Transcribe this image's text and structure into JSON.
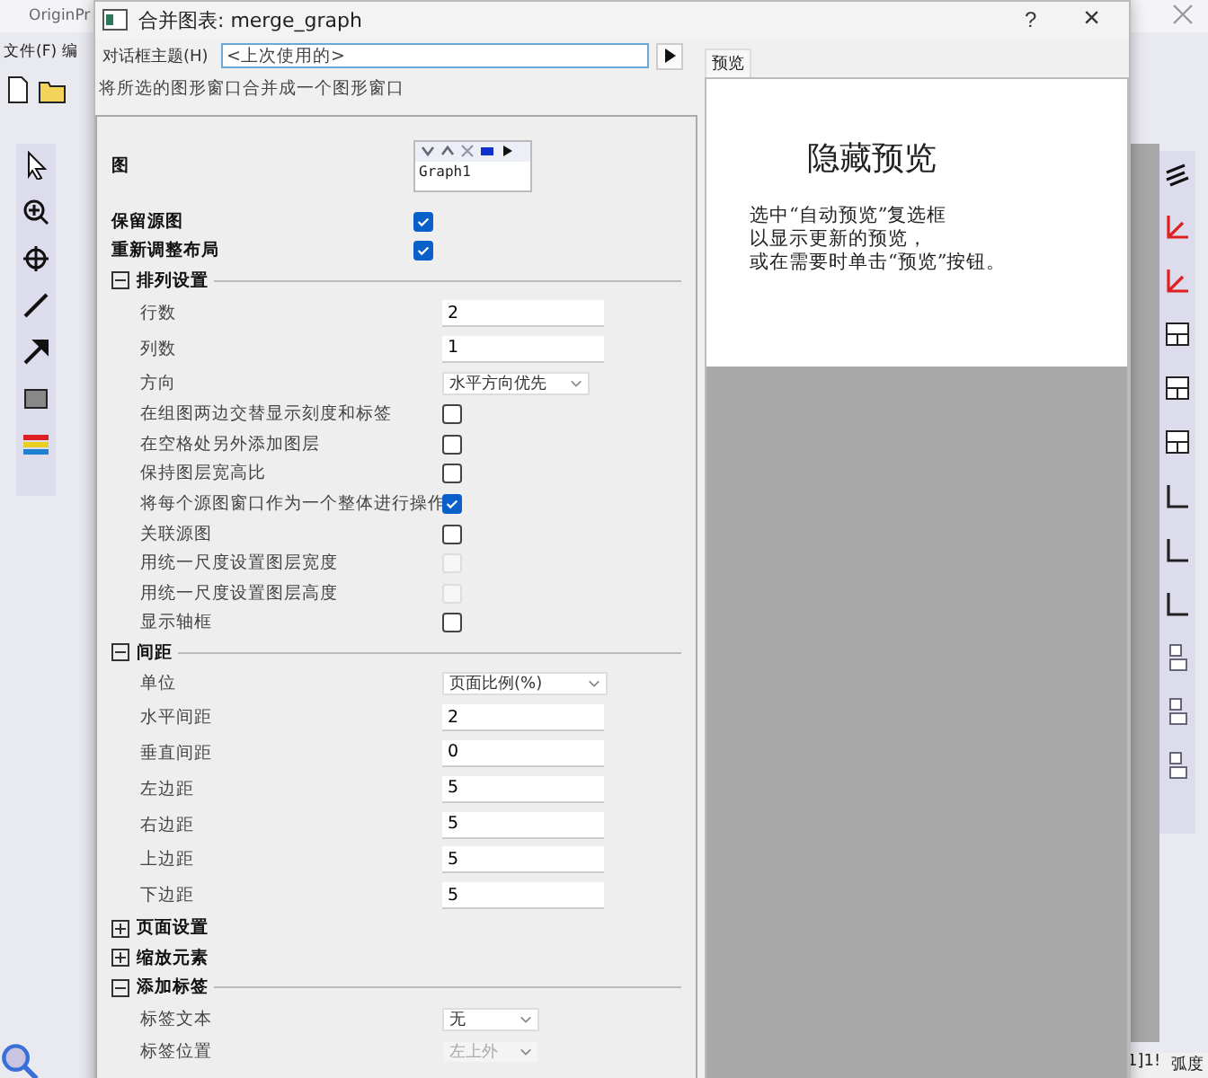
{
  "app": {
    "title": "OriginPr",
    "menu": [
      "文件(F)",
      "编"
    ],
    "status_bar": [
      "1]1!",
      "弧度"
    ]
  },
  "dialog": {
    "title": "合并图表: merge_graph",
    "help": "?",
    "close": "×",
    "theme": {
      "label": "对话框主题(H)",
      "value": "<上次使用的>"
    },
    "description": "将所选的图形窗口合并成一个图形窗口",
    "items": [
      {
        "kind": "graphlist",
        "label": "图",
        "graphs": [
          "Graph1"
        ]
      },
      {
        "kind": "check",
        "label": "保留源图",
        "checked": true,
        "disabled": false
      },
      {
        "kind": "check",
        "label": "重新调整布局",
        "checked": true,
        "disabled": false
      },
      {
        "kind": "section",
        "label": "排列设置",
        "expanded": true,
        "children": [
          {
            "kind": "input",
            "label": "行数",
            "value": "2"
          },
          {
            "kind": "input",
            "label": "列数",
            "value": "1"
          },
          {
            "kind": "select",
            "label": "方向",
            "value": "水平方向优先",
            "disabled": false
          },
          {
            "kind": "check",
            "label": "在组图两边交替显示刻度和标签",
            "checked": false,
            "disabled": false
          },
          {
            "kind": "check",
            "label": "在空格处另外添加图层",
            "checked": false,
            "disabled": false
          },
          {
            "kind": "check",
            "label": "保持图层宽高比",
            "checked": false,
            "disabled": false
          },
          {
            "kind": "check",
            "label": "将每个源图窗口作为一个整体进行操作",
            "checked": true,
            "disabled": false
          },
          {
            "kind": "check",
            "label": "关联源图",
            "checked": false,
            "disabled": false
          },
          {
            "kind": "check",
            "label": "用统一尺度设置图层宽度",
            "checked": false,
            "disabled": true
          },
          {
            "kind": "check",
            "label": "用统一尺度设置图层高度",
            "checked": false,
            "disabled": true
          },
          {
            "kind": "check",
            "label": "显示轴框",
            "checked": false,
            "disabled": false
          }
        ]
      },
      {
        "kind": "section",
        "label": "间距",
        "expanded": true,
        "children": [
          {
            "kind": "select",
            "label": "单位",
            "value": "页面比例(%)",
            "disabled": false
          },
          {
            "kind": "input",
            "label": "水平间距",
            "value": "2"
          },
          {
            "kind": "input",
            "label": "垂直间距",
            "value": "0"
          },
          {
            "kind": "input",
            "label": "左边距",
            "value": "5"
          },
          {
            "kind": "input",
            "label": "右边距",
            "value": "5"
          },
          {
            "kind": "input",
            "label": "上边距",
            "value": "5"
          },
          {
            "kind": "input",
            "label": "下边距",
            "value": "5"
          }
        ]
      },
      {
        "kind": "section",
        "label": "页面设置",
        "expanded": false
      },
      {
        "kind": "section",
        "label": "缩放元素",
        "expanded": false
      },
      {
        "kind": "section",
        "label": "添加标签",
        "expanded": true,
        "children": [
          {
            "kind": "select",
            "label": "标签文本",
            "value": "无",
            "disabled": false
          },
          {
            "kind": "select",
            "label": "标签位置",
            "value": "左上外",
            "disabled": true
          }
        ]
      }
    ],
    "preview": {
      "tab": "预览",
      "heading": "隐藏预览",
      "lines": [
        "选中“自动预览”复选框",
        "以显示更新的预览，",
        "或在需要时单击“预览”按钮。"
      ]
    }
  }
}
